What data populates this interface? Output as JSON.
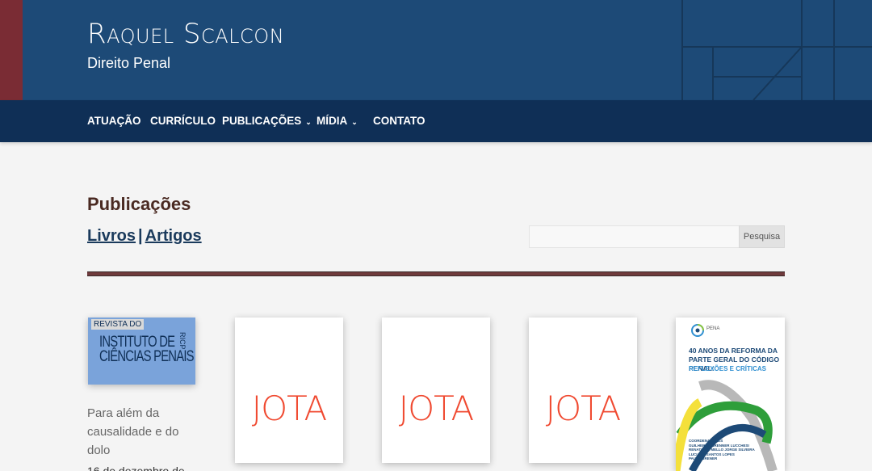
{
  "header": {
    "title": "Raquel Scalcon",
    "subtitle": "Direito Penal",
    "accent_color": "#7a2c34",
    "bg_color": "#1d4a77"
  },
  "nav": {
    "items": [
      {
        "label": "ATUAÇÃO"
      },
      {
        "label": "CURRÍCULO"
      },
      {
        "label": "PUBLICAÇÕES",
        "chevron": "⌄"
      },
      {
        "label": "MÍDIA",
        "chevron": "⌄"
      },
      {
        "label": "CONTATO"
      }
    ]
  },
  "main": {
    "heading": "Publicações",
    "links": {
      "books": "Livros",
      "separator": "|",
      "articles": "Artigos"
    },
    "search": {
      "placeholder": "",
      "button": "Pesquisa"
    }
  },
  "publications": [
    {
      "cover": "ricp",
      "cover_label": "REVISTA DO",
      "cover_line1": "INSTITUTO DE",
      "cover_line2": "CIÊNCIAS PENAIS",
      "cover_vertical": "RICP",
      "title": "Para além da causalidade e do dolo",
      "date": "16 de dezembro de"
    },
    {
      "cover": "jota",
      "cover_text": "JOTA"
    },
    {
      "cover": "jota",
      "cover_text": "JOTA"
    },
    {
      "cover": "jota",
      "cover_text": "JOTA"
    },
    {
      "cover": "book",
      "logo_text": "PENA",
      "book_title": "40 ANOS DA REFORMA DA PARTE GERAL DO CÓDIGO PENAL:",
      "book_subtitle": "REFLEXÕES E CRÍTICAS",
      "credits": [
        "COORDENADORES",
        "GUILHERME BRENNER LUCCHESI",
        "RENATO DE MELLO JORGE SILVEIRA",
        "LUCIANO SANTOS LOPES",
        "PAULA BRENER"
      ]
    }
  ]
}
